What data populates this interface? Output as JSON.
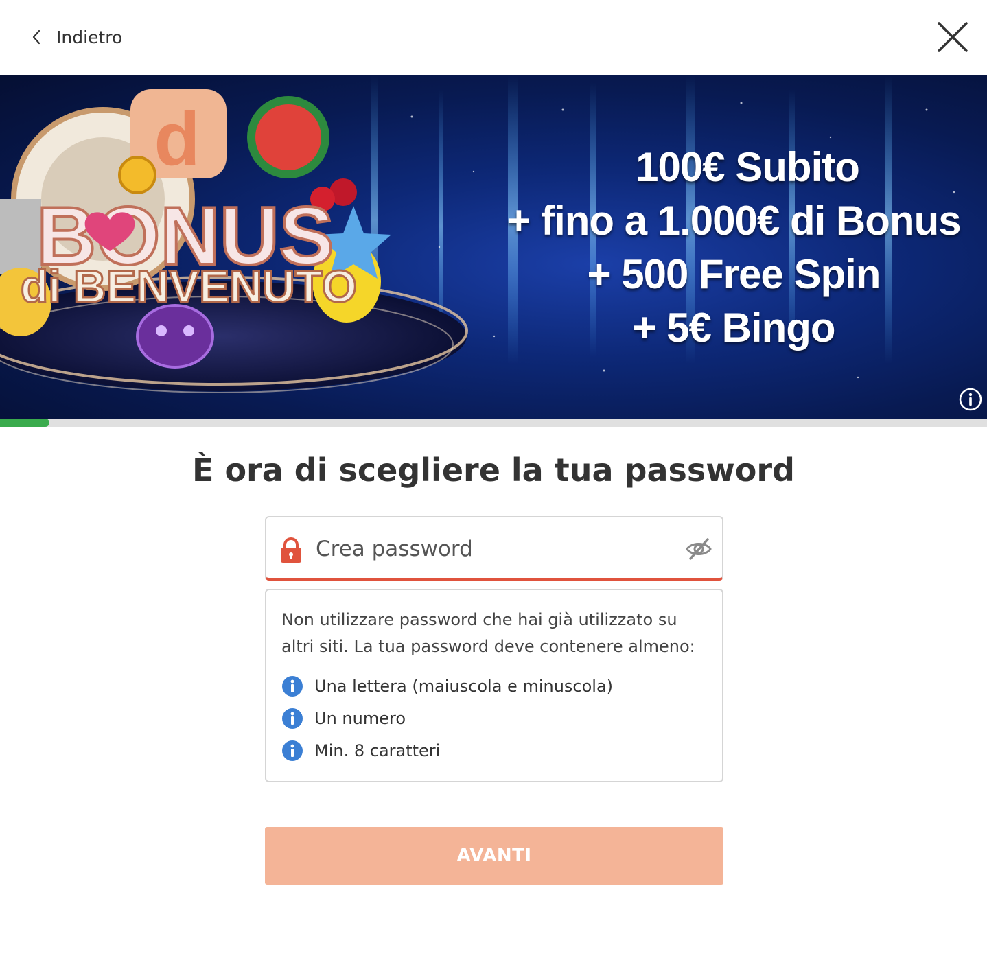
{
  "header": {
    "back_label": "Indietro",
    "back_icon": "chevron-left-icon",
    "close_icon": "close-icon"
  },
  "banner": {
    "lines": [
      "100€ Subito",
      "+ fino a 1.000€ di Bonus",
      "+ 500 Free Spin",
      "+ 5€ Bingo"
    ],
    "logo_text": [
      "BONUS",
      "di BENVENUTO"
    ],
    "info_icon": "info-circle-icon"
  },
  "progress": {
    "value": 0.05,
    "color": "#3aab4d"
  },
  "heading": {
    "prefix": "È ora di scegliere la tua ",
    "bold": "password"
  },
  "password": {
    "placeholder": "Crea password",
    "value": "",
    "lock_icon": "lock-icon",
    "toggle_icon": "eye-off-icon",
    "accent": "#e0533d"
  },
  "rules": {
    "intro": "Non utilizzare password che hai già utilizzato su altri siti. La tua password deve contenere almeno:",
    "items": [
      "Una lettera (maiuscola e minuscola)",
      "Un numero",
      "Min. 8 caratteri"
    ],
    "icon": "info-icon",
    "icon_color": "#3b7fd4"
  },
  "submit": {
    "label": "AVANTI",
    "color": "#f4b497"
  }
}
